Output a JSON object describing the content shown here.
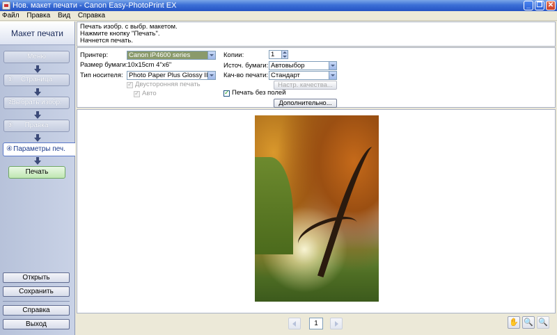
{
  "window": {
    "title": "Нов. макет печати - Canon Easy-PhotoPrint EX",
    "controls": [
      "_",
      "❐",
      "✕"
    ]
  },
  "menu": [
    "Файл",
    "Правка",
    "Вид",
    "Справка"
  ],
  "sidebar": {
    "title": "Макет печати",
    "steps": [
      {
        "num": "",
        "label": "Меню"
      },
      {
        "num": "①",
        "label": "Страница"
      },
      {
        "num": "②",
        "label": "Выбрать изобр."
      },
      {
        "num": "③",
        "label": "Правка"
      },
      {
        "num": "④",
        "label": "Параметры печ."
      }
    ],
    "print_label": "Печать",
    "open_label": "Открыть",
    "save_label": "Сохранить",
    "help_label": "Справка",
    "exit_label": "Выход"
  },
  "info": {
    "lines": [
      "Печать изобр. с выбр. макетом.",
      "Нажмите кнопку \"Печать\".",
      "Начнется печать."
    ]
  },
  "settings": {
    "printer_label": "Принтер:",
    "printer_value": "Canon iP4600 series",
    "paper_size_label": "Размер бумаги:",
    "paper_size_value": "10x15cm 4\"x6\"",
    "media_type_label": "Тип носителя:",
    "media_type_value": "Photo Paper Plus Glossy II",
    "duplex_label": "Двусторонняя печать",
    "auto_label": "Авто",
    "copies_label": "Копии:",
    "copies_value": "1",
    "paper_source_label": "Источ. бумаги:",
    "paper_source_value": "Автовыбор",
    "quality_label": "Кач-во печати:",
    "quality_value": "Стандарт",
    "quality_settings_label": "Настр. качества...",
    "borderless_label": "Печать без полей",
    "advanced_label": "Дополнительно..."
  },
  "pager": {
    "page": "1"
  },
  "toolbar": {
    "hand_icon": "✋",
    "zoom_in_icon": "🔍",
    "zoom_out_icon": "🔍"
  }
}
